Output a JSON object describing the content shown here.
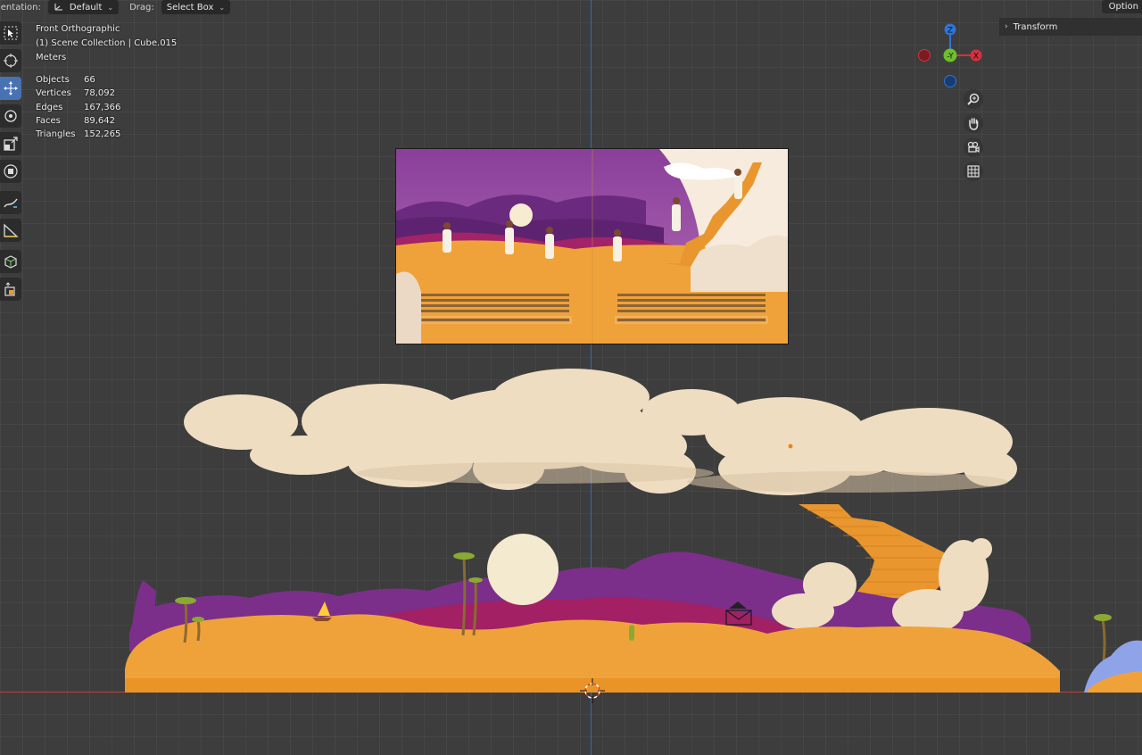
{
  "header": {
    "orientation_label": "ientation:",
    "orientation_value": "Default",
    "drag_label": "Drag:",
    "drag_value": "Select Box",
    "options_label": "Option"
  },
  "viewport_info": {
    "view_name": "Front Orthographic",
    "collection": "(1) Scene Collection | Cube.015",
    "units": "Meters",
    "stats": [
      {
        "label": "Objects",
        "value": "66"
      },
      {
        "label": "Vertices",
        "value": "78,092"
      },
      {
        "label": "Edges",
        "value": "167,366"
      },
      {
        "label": "Faces",
        "value": "89,642"
      },
      {
        "label": "Triangles",
        "value": "152,265"
      }
    ]
  },
  "sidebar_panel": {
    "transform_label": "Transform"
  },
  "gizmo": {
    "z_label": "Z",
    "x_label": "X",
    "y_label": "-Y",
    "colors": {
      "z": "#2f74d6",
      "x": "#d6303c",
      "y": "#6dbf2a",
      "neg_x": "#7a1b22",
      "neg_z": "#173d70"
    }
  },
  "toolbar": {
    "tools": [
      "select-box",
      "cursor",
      "move",
      "rotate",
      "scale",
      "transform",
      "annotate",
      "measure",
      "add-cube",
      "extrude"
    ],
    "active_tool": "move"
  },
  "colors": {
    "viewport_bg": "#3d3d3d",
    "sand": "#f0a23a",
    "purple": "#7b2f8a",
    "magenta": "#a22063",
    "cloud": "#efddc2",
    "stairs": "#e9962e",
    "accent_blue": "#4772b3"
  }
}
